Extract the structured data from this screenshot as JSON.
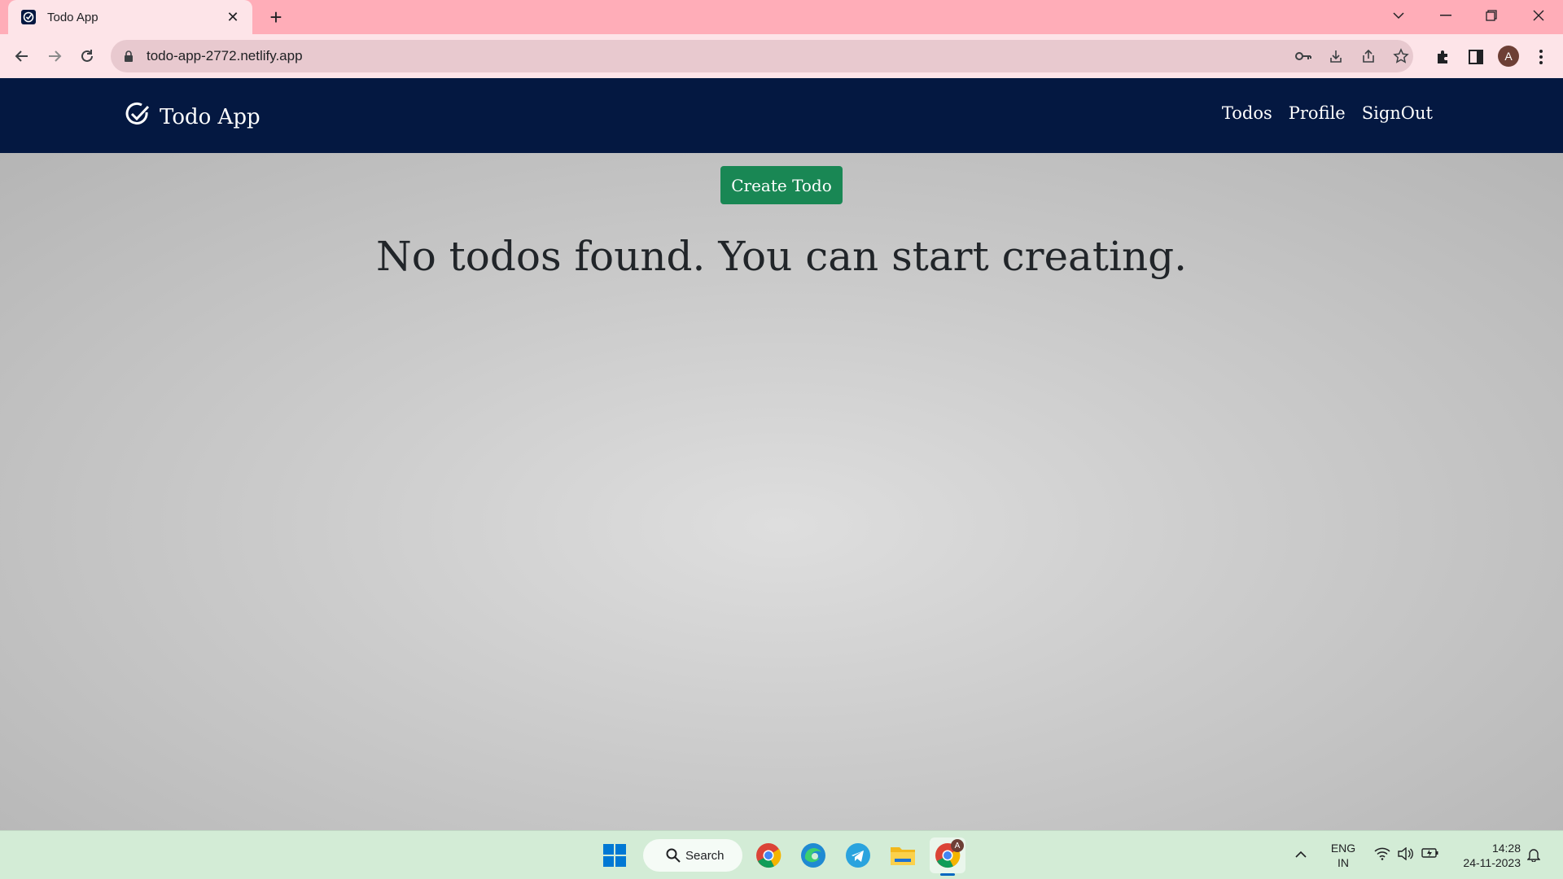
{
  "browser": {
    "tab_title": "Todo App",
    "url": "todo-app-2772.netlify.app",
    "profile_initial": "A"
  },
  "app": {
    "brand": "Todo App",
    "nav": [
      "Todos",
      "Profile",
      "SignOut"
    ],
    "create_button": "Create Todo",
    "empty_message": "No todos found. You can start creating.",
    "colors": {
      "navbar": "#041841",
      "create_button": "#198754"
    }
  },
  "taskbar": {
    "search_label": "Search",
    "language": "ENG",
    "region": "IN",
    "time": "14:28",
    "date": "24-11-2023",
    "badge": "A"
  }
}
